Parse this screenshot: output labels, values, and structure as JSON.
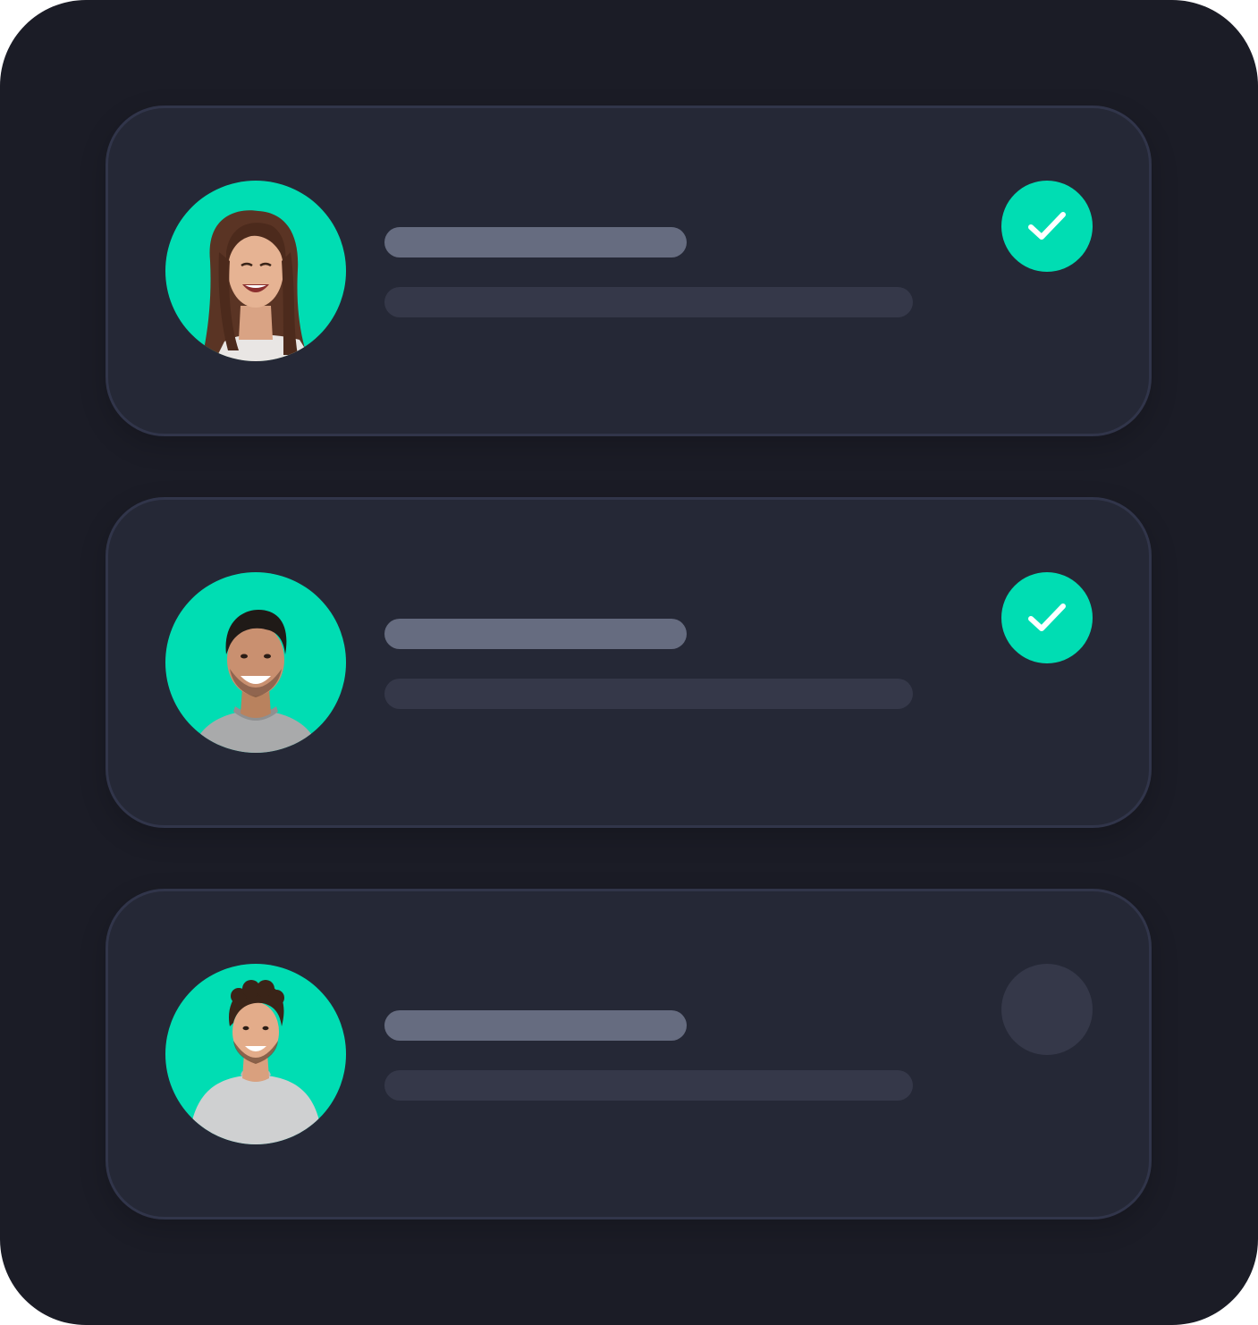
{
  "colors": {
    "background": "#1b1c26",
    "card": "#252836",
    "card_border": "#31354a",
    "accent": "#00ddb3",
    "placeholder_title": "#666c80",
    "placeholder_subtitle": "#353849",
    "status_pending": "#353849"
  },
  "items": [
    {
      "avatar": "woman-long-hair-portrait",
      "status": "checked",
      "status_icon": "check-icon"
    },
    {
      "avatar": "man-short-beard-portrait",
      "status": "checked",
      "status_icon": "check-icon"
    },
    {
      "avatar": "man-curly-hair-portrait",
      "status": "unchecked",
      "status_icon": "empty-circle"
    }
  ]
}
